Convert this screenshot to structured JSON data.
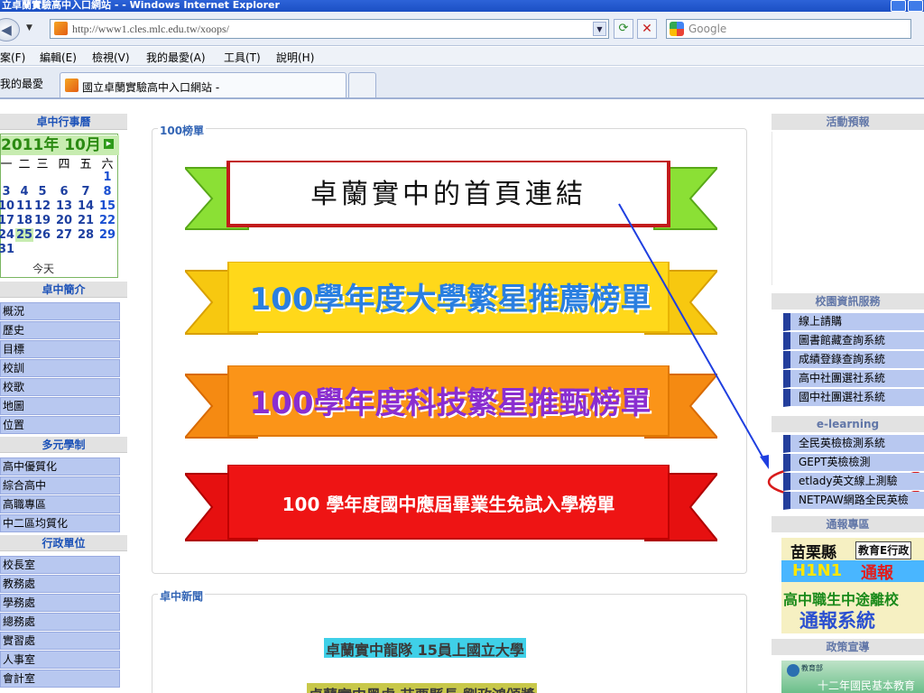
{
  "window": {
    "title": "立卓蘭實驗高中入口網站 - - Windows Internet Explorer"
  },
  "address": {
    "url": "http://www1.cles.mlc.edu.tw/xoops/",
    "search_placeholder": "Google"
  },
  "menu": [
    "案(F)",
    "編輯(E)",
    "檢視(V)",
    "我的最愛(A)",
    "工具(T)",
    "說明(H)"
  ],
  "favorites_label": "我的最愛",
  "tab": {
    "title": "國立卓蘭實驗高中入口網站 -"
  },
  "left": {
    "calendar_title": "卓中行事曆",
    "calendar": {
      "month_label": "2011年 10月",
      "weekdays": [
        "一",
        "二",
        "三",
        "四",
        "五",
        "六"
      ],
      "weeks": [
        [
          "",
          "",
          "",
          "",
          "",
          "1"
        ],
        [
          "3",
          "4",
          "5",
          "6",
          "7",
          "8"
        ],
        [
          "10",
          "11",
          "12",
          "13",
          "14",
          "15"
        ],
        [
          "17",
          "18",
          "19",
          "20",
          "21",
          "22"
        ],
        [
          "24",
          "25",
          "26",
          "27",
          "28",
          "29"
        ],
        [
          "31",
          "",
          "",
          "",
          "",
          ""
        ]
      ],
      "today_label": "今天"
    },
    "sections": [
      {
        "title": "卓中簡介",
        "items": [
          "概況",
          "歷史",
          "目標",
          "校訓",
          "校歌",
          "地圖",
          "位置"
        ]
      },
      {
        "title": "多元學制",
        "items": [
          "高中優質化",
          "綜合高中",
          "高職專區",
          "中二區均質化"
        ]
      },
      {
        "title": "行政單位",
        "items": [
          "校長室",
          "教務處",
          "學務處",
          "總務處",
          "實習處",
          "人事室",
          "會計室"
        ]
      }
    ]
  },
  "center": {
    "honor": {
      "legend": "100榜單",
      "banners": [
        "卓蘭實中的首頁連結",
        "100學年度大學繁星推薦榜單",
        "100學年度科技繁星推甄榜單",
        "100 學年度國中應屆畢業生免試入學榜單"
      ]
    },
    "news": {
      "legend": "卓中新聞",
      "items": [
        "卓蘭實中龍隊 15員上國立大學",
        "卓蘭實中黑虎 苗栗縣長 劉政鴻頒獎"
      ]
    }
  },
  "right": {
    "activity_title": "活動預報",
    "campus_title": "校園資訊服務",
    "campus_items": [
      "線上請購",
      "圖書館藏查詢系統",
      "成績登錄查詢系統",
      "高中社團選社系統",
      "國中社團選社系統"
    ],
    "elearning_title": "e-learning",
    "elearning_items": [
      "全民英檢檢測系統",
      "GEPT英檢檢測",
      "etlady英文線上測驗",
      "NETPAW網路全民英檢"
    ],
    "report_title": "通報專區",
    "report_banner": {
      "county": "苗栗縣",
      "label": "教育E行政",
      "line1": "H1N1",
      "line1b": "通報",
      "line2": "高中職生中途離校",
      "line3": "通報系統"
    },
    "policy_title": "政策宣導",
    "policy_banner": {
      "org": "教育部",
      "text": "十二年國民基本教育"
    }
  },
  "colors": {
    "nav_bg": "#b8c8f0",
    "head_text": "#1c52b8",
    "calendar_green": "#2b8a12"
  }
}
